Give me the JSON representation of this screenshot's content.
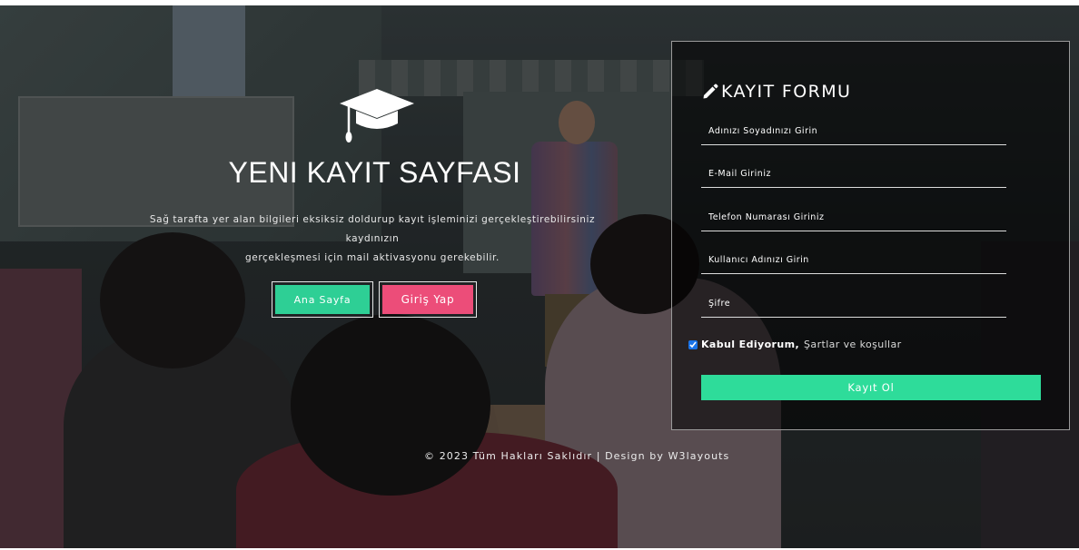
{
  "hero": {
    "title": "YENI KAYIT SAYFASI",
    "description_line1": "Sağ tarafta yer alan bilgileri eksiksiz doldurup kayıt işleminizi gerçekleştirebilirsiniz kaydınızın",
    "description_line2": "gerçekleşmesi için mail aktivasyonu gerekebilir.",
    "icon": "graduation-cap-icon",
    "buttons": {
      "home_label": "Ana Sayfa",
      "login_label": "Giriş Yap"
    }
  },
  "form": {
    "title": "KAYIT FORMU",
    "title_icon": "pencil-icon",
    "fields": {
      "fullname_placeholder": "Adınızı Soyadınızı Girin",
      "email_placeholder": "E-Mail Giriniz",
      "phone_placeholder": "Telefon Numarası Giriniz",
      "username_placeholder": "Kullanıcı Adınızı Girin",
      "password_placeholder": "Şifre"
    },
    "terms": {
      "checked": true,
      "accept_label": "Kabul Ediyorum,",
      "link_label": "Şartlar ve koşullar"
    },
    "submit_label": "Kayıt Ol"
  },
  "footer": {
    "text": "© 2023 Tüm Hakları Saklıdır | Design by W3layouts"
  },
  "colors": {
    "primary_green": "#2edc9a",
    "login_pink": "#ec4d79",
    "panel_border": "#9a9a9a"
  }
}
